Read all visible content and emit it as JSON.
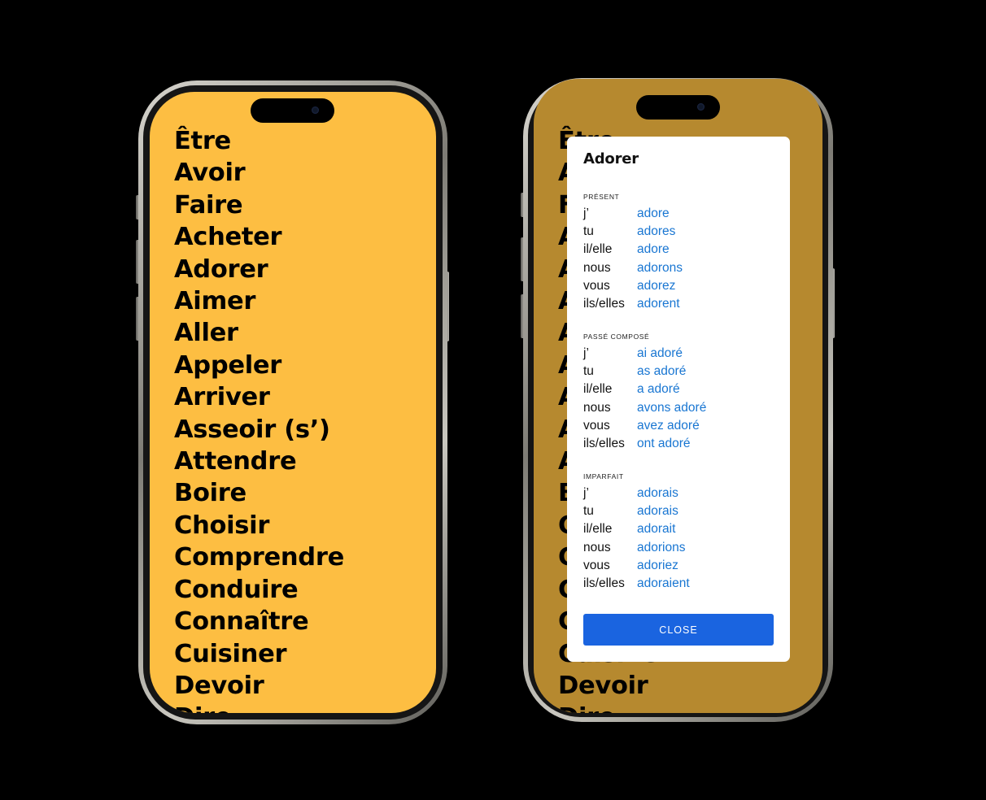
{
  "verbs": [
    "Être",
    "Avoir",
    "Faire",
    "Acheter",
    "Adorer",
    "Aimer",
    "Aller",
    "Appeler",
    "Arriver",
    "Asseoir (s’)",
    "Attendre",
    "Boire",
    "Choisir",
    "Comprendre",
    "Conduire",
    "Connaître",
    "Cuisiner",
    "Devoir",
    "Dire"
  ],
  "dialog": {
    "title": "Adorer",
    "sections": [
      {
        "caption": "PRÉSENT",
        "rows": [
          [
            "j’",
            "adore"
          ],
          [
            "tu",
            "adores"
          ],
          [
            "il/elle",
            "adore"
          ],
          [
            "nous",
            "adorons"
          ],
          [
            "vous",
            "adorez"
          ],
          [
            "ils/elles",
            "adorent"
          ]
        ]
      },
      {
        "caption": "PASSÉ COMPOSÉ",
        "rows": [
          [
            "j’",
            "ai adoré"
          ],
          [
            "tu",
            "as adoré"
          ],
          [
            "il/elle",
            "a adoré"
          ],
          [
            "nous",
            "avons adoré"
          ],
          [
            "vous",
            "avez adoré"
          ],
          [
            "ils/elles",
            "ont adoré"
          ]
        ]
      },
      {
        "caption": "IMPARFAIT",
        "rows": [
          [
            "j’",
            "adorais"
          ],
          [
            "tu",
            "adorais"
          ],
          [
            "il/elle",
            "adorait"
          ],
          [
            "nous",
            "adorions"
          ],
          [
            "vous",
            "adoriez"
          ],
          [
            "ils/elles",
            "adoraient"
          ]
        ]
      }
    ],
    "close_label": "CLOSE"
  },
  "colors": {
    "screen_bg": "#FDBE42",
    "form_text": "#1976D2",
    "close_button": "#1A64E0"
  },
  "icons": {
    "camera": "front-camera-icon"
  }
}
